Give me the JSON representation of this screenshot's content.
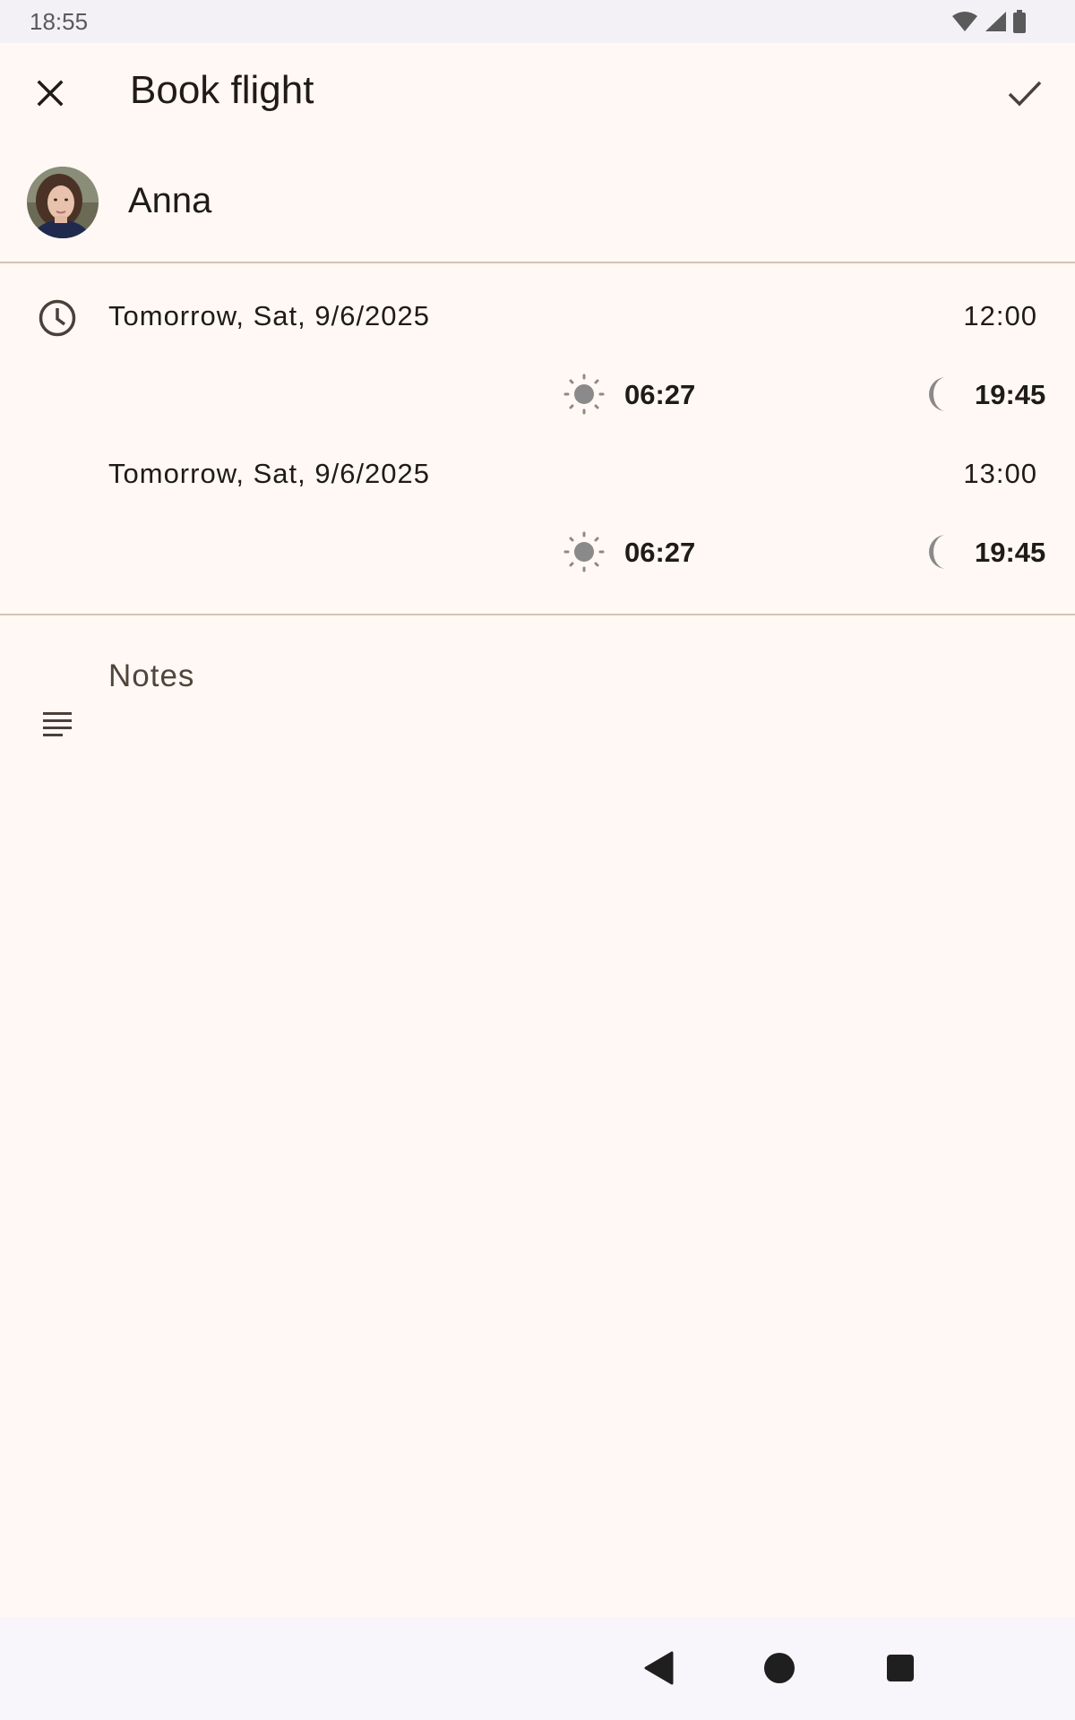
{
  "status_bar": {
    "time": "18:55",
    "icons": [
      "wifi-icon",
      "signal-icon",
      "battery-icon"
    ]
  },
  "app_bar": {
    "title": "Book flight",
    "close_icon": "close-icon",
    "save_icon": "check-icon"
  },
  "contact": {
    "name": "Anna",
    "avatar": "avatar-photo"
  },
  "time_slots": [
    {
      "date": "Tomorrow, Sat, 9/6/2025",
      "time": "12:00",
      "sunrise": "06:27",
      "sunset": "19:45"
    },
    {
      "date": "Tomorrow, Sat, 9/6/2025",
      "time": "13:00",
      "sunrise": "06:27",
      "sunset": "19:45"
    }
  ],
  "notes": {
    "label": "Notes",
    "value": ""
  },
  "nav_bar": {
    "buttons": [
      "back-icon",
      "home-icon",
      "recents-icon"
    ]
  },
  "colors": {
    "background": "#fff8f5",
    "divider": "#d8c3ae",
    "icon": "#4a4039",
    "sun_moon": "#8a8a8a"
  }
}
